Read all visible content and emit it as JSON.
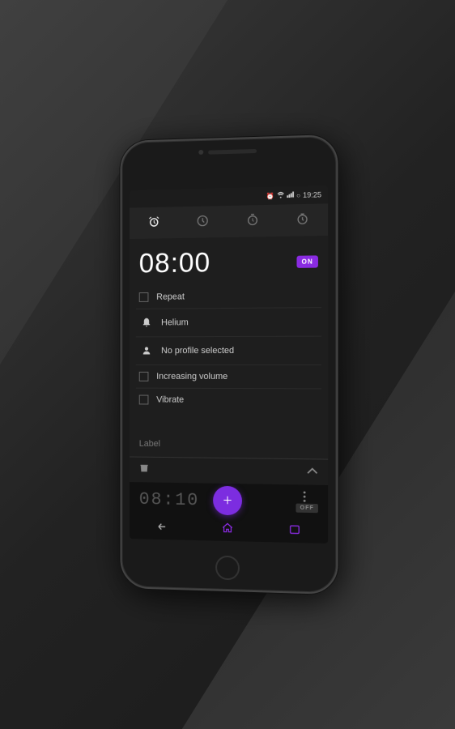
{
  "background": {
    "color": "#2a2a2a"
  },
  "phone": {
    "status_bar": {
      "time": "19:25",
      "icons": [
        "alarm",
        "wifi",
        "signal",
        "battery"
      ]
    },
    "tabs": [
      {
        "id": "alarm",
        "label": "⏰",
        "active": true
      },
      {
        "id": "clock",
        "label": "🕐",
        "active": false
      },
      {
        "id": "timer",
        "label": "⧗",
        "active": false
      },
      {
        "id": "stopwatch",
        "label": "⏱",
        "active": false
      }
    ],
    "alarm_main": {
      "time": "08:00",
      "toggle_label": "ON",
      "toggle_on": true
    },
    "settings": [
      {
        "type": "checkbox",
        "checked": false,
        "label": "Repeat"
      },
      {
        "type": "bell",
        "label": "Helium"
      },
      {
        "type": "person",
        "label": "No profile selected"
      },
      {
        "type": "checkbox",
        "checked": false,
        "label": "Increasing volume"
      },
      {
        "type": "checkbox",
        "checked": false,
        "label": "Vibrate"
      }
    ],
    "label_field": {
      "placeholder": "Label",
      "value": "Label"
    },
    "action_bar": {
      "delete_icon": "🗑",
      "chevron_icon": "⌃"
    },
    "alarm_secondary": {
      "time": "08:10",
      "toggle_label": "OFF",
      "toggle_on": false
    },
    "fab": {
      "label": "+"
    },
    "nav_bar": {
      "back": "↩",
      "home": "⌂",
      "recents": "☐"
    }
  }
}
